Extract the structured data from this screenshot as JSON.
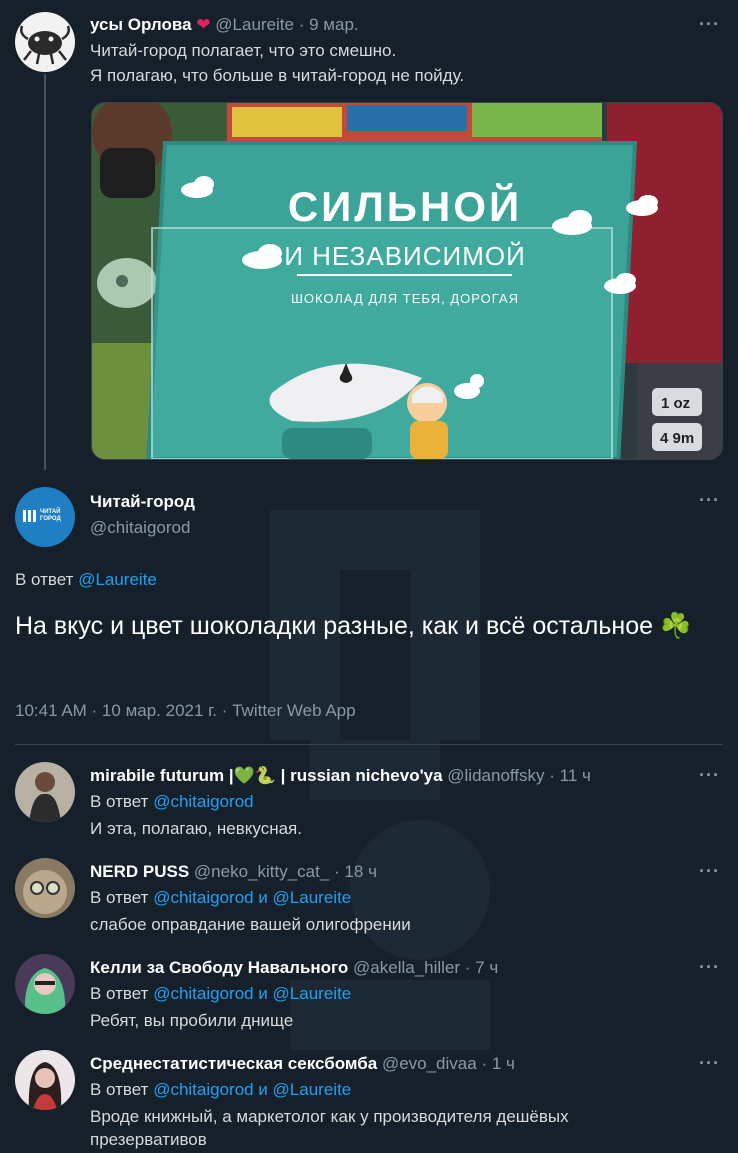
{
  "tweet1": {
    "name": "усы Орлова",
    "handle": "@Laureite",
    "date": "9 мар.",
    "line1": "Читай-город полагает, что это смешно.",
    "line2": "Я полагаю, что больше в читай-город не пойду.",
    "photo": {
      "book_title_1": "СИЛЬНОЙ",
      "book_title_2": "И НЕЗАВИСИМОЙ",
      "book_subtitle": "ШОКОЛАД ДЛЯ ТЕБЯ, ДОРОГАЯ"
    }
  },
  "tweet2": {
    "name": "Читай-город",
    "handle": "@chitaigorod",
    "avatar_text_1": "ЧИТАЙ",
    "avatar_text_2": "ГОРОД",
    "reply_prefix": "В ответ",
    "reply_to": "@Laureite",
    "text": "На вкус и цвет шоколадки разные, как и всё остальное",
    "emoji": "☘️",
    "meta": "10:41 AM · 10 мар. 2021 г. · Twitter Web App"
  },
  "replies": [
    {
      "name": "mirabile futurum |💚🐍 | russian nichevo'ya",
      "handle": "@lidanoffsky",
      "time": "· 11 ч",
      "reply_prefix": "В ответ",
      "reply_to": "@chitaigorod",
      "text": "И эта, полагаю, невкусная."
    },
    {
      "name": "NERD PUSS",
      "handle": "@neko_kitty_cat_",
      "time": "· 18 ч",
      "reply_prefix": "В ответ",
      "reply_to": "@chitaigorod и @Laureite",
      "text": "слабое оправдание вашей олигофрении"
    },
    {
      "name": "Келли за Свободу Навального",
      "handle": "@akella_hiller",
      "time": "· 7 ч",
      "reply_prefix": "В ответ",
      "reply_to": "@chitaigorod и @Laureite",
      "text": "Ребят, вы пробили днище"
    },
    {
      "name": "Среднестатистическая сексбомба",
      "handle": "@evo_divaa",
      "time": "· 1 ч",
      "reply_prefix": "В ответ",
      "reply_to": "@chitaigorod и @Laureite",
      "text_line1": "Вроде книжный, а маркетолог как у производителя дешёвых",
      "text_line2": "презервативов"
    }
  ],
  "more_glyph": "···",
  "colors": {
    "background": "#15202b",
    "link": "#1da1f2",
    "muted": "#8899a6",
    "heart": "#e0245e"
  }
}
